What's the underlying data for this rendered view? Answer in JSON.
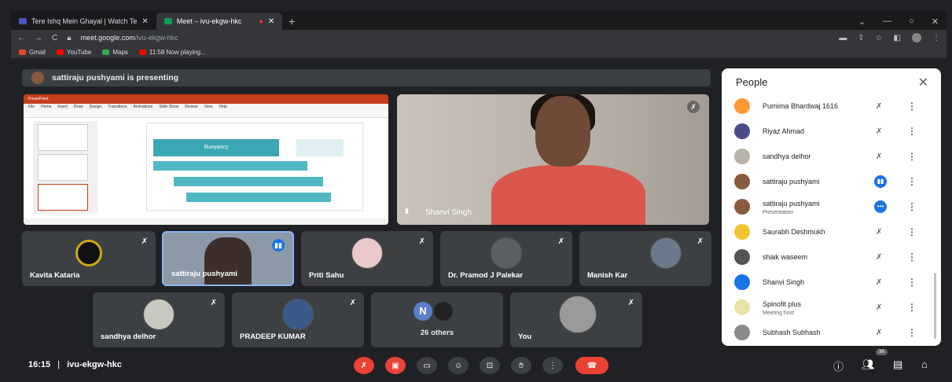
{
  "browser": {
    "tabs": [
      {
        "title": "Tere Ishq Mein Ghayal | Watch Te",
        "active": false,
        "fav_color": "#4b56c7"
      },
      {
        "title": "Meet – ivu-ekgw-hkc",
        "active": true,
        "fav_color": "#0f9d58"
      }
    ],
    "recording_dot": "●",
    "url_host": "meet.google.com",
    "url_path": "/ivu-ekgw-hkc",
    "bookmarks": [
      {
        "label": "Gmail",
        "color": "#ea4335"
      },
      {
        "label": "YouTube",
        "color": "#ff0000"
      },
      {
        "label": "Maps",
        "color": "#34a853"
      },
      {
        "label": "11:58 Now playing...",
        "color": "#ff0000"
      }
    ]
  },
  "banner": {
    "text": "sattiraju pushyami is presenting"
  },
  "presentation": {
    "app": "PowerPoint",
    "menu": [
      "File",
      "Home",
      "Insert",
      "Draw",
      "Design",
      "Transitions",
      "Animations",
      "Slide Show",
      "Review",
      "View",
      "Help"
    ],
    "slide_title": "Buoyancy"
  },
  "camera_tile": {
    "name": "Shanvi Singh"
  },
  "tiles_row1": [
    {
      "name": "Kavita Kataria",
      "mic": "muted"
    },
    {
      "name": "sattiraju pushyami",
      "mic": "active"
    },
    {
      "name": "Priti Sahu",
      "mic": "muted"
    },
    {
      "name": "Dr. Pramod J Palekar",
      "mic": "muted"
    },
    {
      "name": "Manish Kar",
      "mic": "muted"
    }
  ],
  "tiles_row2": [
    {
      "name": "sandhya delhor",
      "mic": "muted"
    },
    {
      "name": "PRADEEP KUMAR",
      "mic": "muted"
    },
    {
      "name": "26 others",
      "initial": "N"
    },
    {
      "name": "You",
      "mic": "muted"
    }
  ],
  "people_panel": {
    "title": "People",
    "close": "✕",
    "people": [
      {
        "name": "Purnima Bhardwaj 1616",
        "sub": "",
        "mic": "muted",
        "av": "#ff9933"
      },
      {
        "name": "Riyaz Ahmad",
        "sub": "",
        "mic": "muted",
        "av": "#4a4a8a"
      },
      {
        "name": "sandhya delhor",
        "sub": "",
        "mic": "muted",
        "av": "#b8b2a8"
      },
      {
        "name": "sattiraju pushyami",
        "sub": "",
        "mic": "speaking",
        "av": "#8a5a3c"
      },
      {
        "name": "sattiraju pushyami",
        "sub": "Presentation",
        "mic": "presenting",
        "av": "#8a5a3c"
      },
      {
        "name": "Saurabh Deshmukh",
        "sub": "",
        "mic": "muted",
        "av": "#f2c230"
      },
      {
        "name": "shaik waseem",
        "sub": "",
        "mic": "muted",
        "av": "#555"
      },
      {
        "name": "Shanvi Singh",
        "sub": "",
        "mic": "muted",
        "av": "#1a73e8"
      },
      {
        "name": "Spinofit plus",
        "sub": "Meeting host",
        "mic": "muted",
        "av": "#e8e3a8"
      },
      {
        "name": "Subhash Subhash",
        "sub": "",
        "mic": "muted",
        "av": "#8a8a8a"
      }
    ]
  },
  "bottom_bar": {
    "time": "16:15",
    "separator": "|",
    "meeting_code": "ivu-ekgw-hkc",
    "participant_count": "36"
  }
}
